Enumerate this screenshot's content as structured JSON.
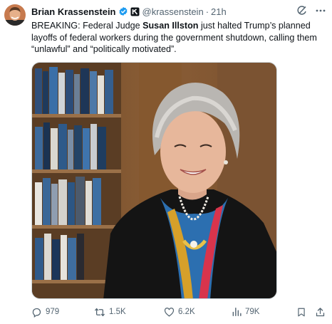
{
  "author": {
    "name": "Brian Krassenstein",
    "handle": "@krassenstein",
    "separator": "·",
    "time": "21h",
    "verified_icon": "verified-badge-icon",
    "affiliation_icon": "affiliate-badge-icon"
  },
  "tweet": {
    "text_pre": "BREAKING: Federal Judge ",
    "text_bold": "Susan Illston",
    "text_post": " just halted Trump’s planned layoffs of federal workers during the government shutdown, calling them “unlawful” and “politically motivated”."
  },
  "header_icons": [
    "grok-icon",
    "more-icon"
  ],
  "actions": {
    "replies": "979",
    "reposts": "1.5K",
    "likes": "6.2K",
    "views": "79K"
  },
  "colors": {
    "text": "#0f1419",
    "secondary": "#536471",
    "verified": "#1d9bf0",
    "border": "#cfd9de"
  }
}
